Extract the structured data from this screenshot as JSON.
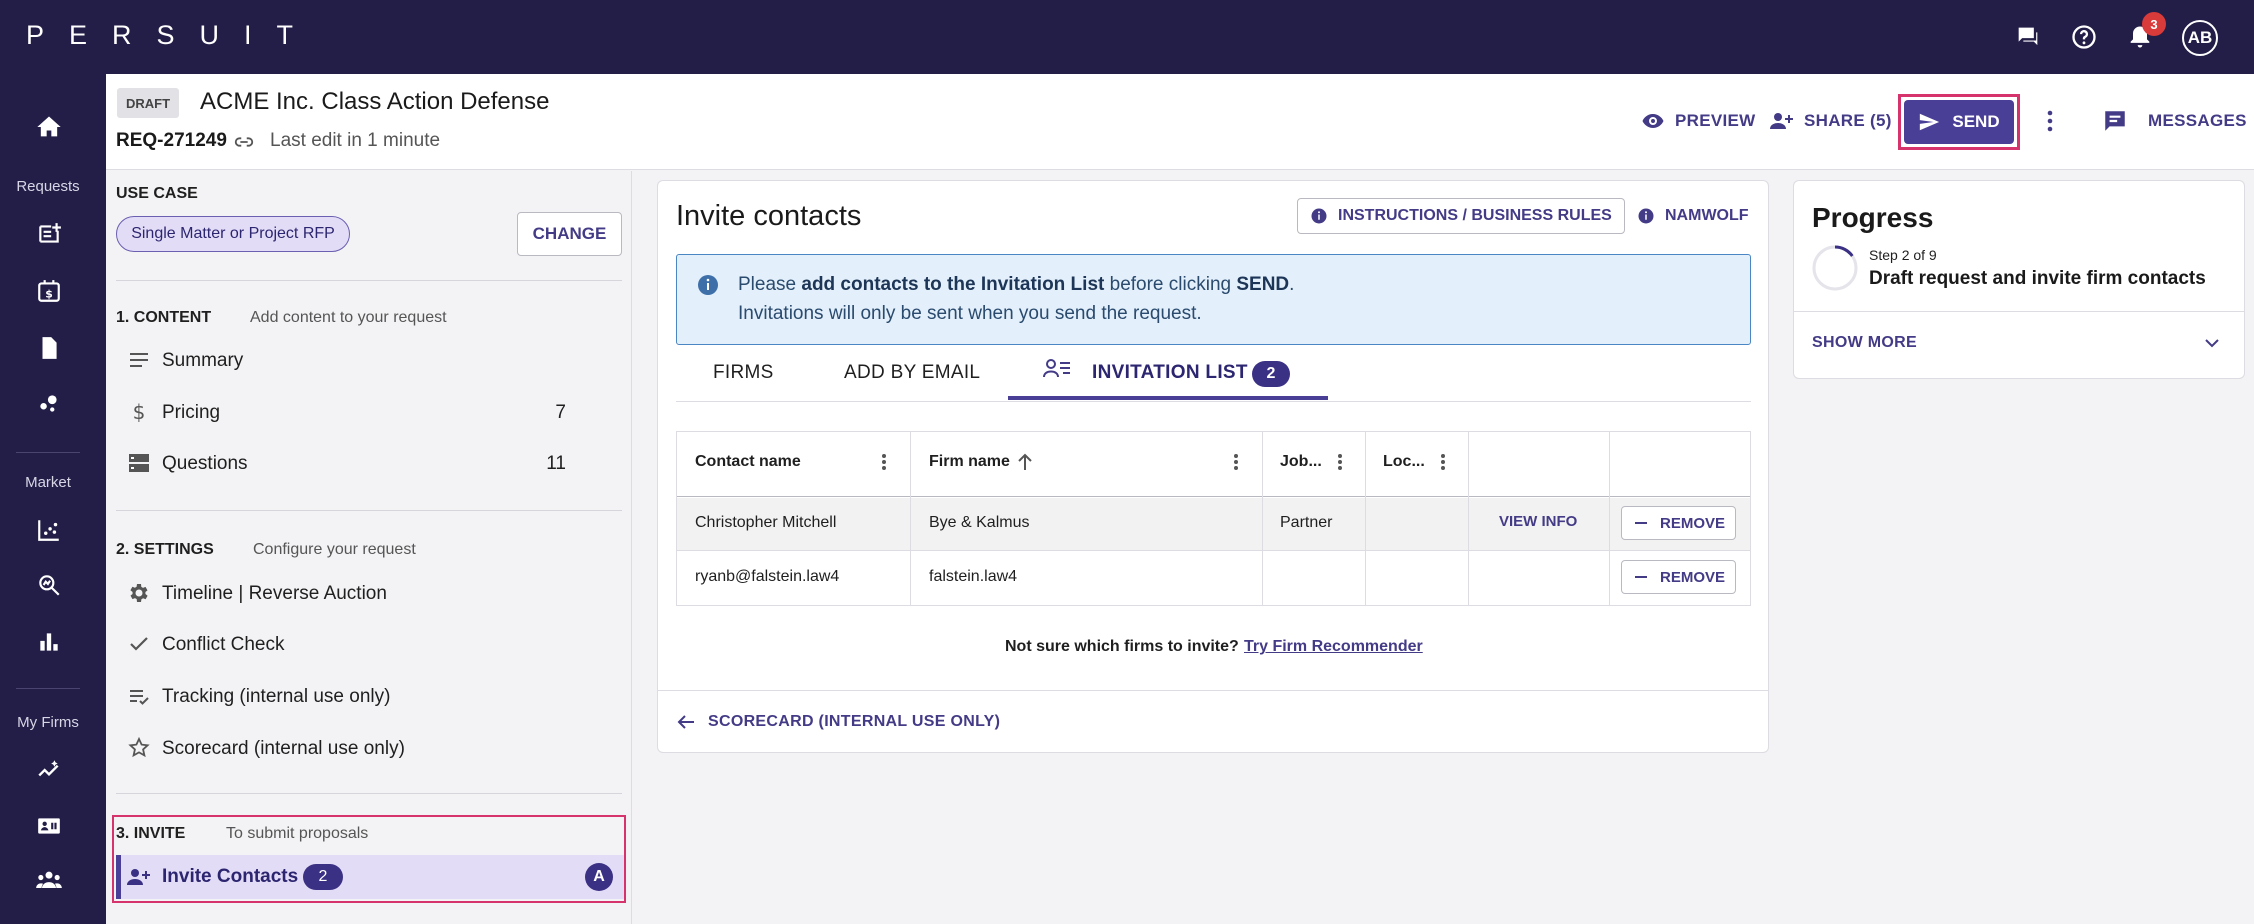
{
  "app": {
    "logo": "PERSUIT"
  },
  "topbar": {
    "notification_count": "3",
    "avatar_initials": "AB"
  },
  "leftnav": {
    "section_requests": "Requests",
    "section_market": "Market",
    "section_my_firms": "My Firms"
  },
  "header": {
    "status_badge": "DRAFT",
    "title": "ACME Inc. Class Action Defense",
    "request_id": "REQ-271249",
    "last_edit": "Last edit in 1 minute",
    "preview_label": "PREVIEW",
    "share_label": "SHARE (5)",
    "send_label": "SEND",
    "messages_label": "MESSAGES"
  },
  "sidebar": {
    "use_case_label": "USE CASE",
    "use_case_value": "Single Matter or Project RFP",
    "change_label": "CHANGE",
    "sections": [
      {
        "title": "1. CONTENT",
        "subtitle": "Add content to your request",
        "items": [
          {
            "label": "Summary",
            "count": ""
          },
          {
            "label": "Pricing",
            "count": "7"
          },
          {
            "label": "Questions",
            "count": "11"
          }
        ]
      },
      {
        "title": "2. SETTINGS",
        "subtitle": "Configure your request",
        "items": [
          {
            "label": "Timeline | Reverse Auction"
          },
          {
            "label": "Conflict Check"
          },
          {
            "label": "Tracking (internal use only)"
          },
          {
            "label": "Scorecard (internal use only)"
          }
        ]
      },
      {
        "title": "3. INVITE",
        "subtitle": "To submit proposals",
        "items": [
          {
            "label": "Invite Contacts",
            "count": "2",
            "status": "A"
          }
        ]
      }
    ]
  },
  "main": {
    "title": "Invite contacts",
    "instructions_label": "INSTRUCTIONS / BUSINESS RULES",
    "namwolf_label": "NAMWOLF",
    "banner": {
      "pre": "Please ",
      "bold1": "add contacts to the Invitation List",
      "mid": " before clicking ",
      "bold2": "SEND",
      "end": ".",
      "line2": "Invitations will only be sent when you send the request."
    },
    "tabs": [
      {
        "label": "FIRMS"
      },
      {
        "label": "ADD BY EMAIL"
      },
      {
        "label": "INVITATION LIST",
        "count": "2",
        "active": true
      }
    ],
    "table": {
      "columns": [
        "Contact name",
        "Firm name",
        "Job...",
        "Loc..."
      ],
      "rows": [
        {
          "contact": "Christopher Mitchell",
          "firm": "Bye & Kalmus",
          "job": "Partner",
          "location": "",
          "view_info": "VIEW INFO",
          "remove": "REMOVE"
        },
        {
          "contact": "ryanb@falstein.law4",
          "firm": "falstein.law4",
          "job": "",
          "location": "",
          "view_info": "",
          "remove": "REMOVE"
        }
      ]
    },
    "recommender_prompt": "Not sure which firms to invite?",
    "recommender_link": "Try Firm Recommender",
    "back_link": "SCORECARD (INTERNAL USE ONLY)"
  },
  "progress": {
    "title": "Progress",
    "step_of": "Step 2 of 9",
    "step_name": "Draft request and invite firm contacts",
    "show_more": "SHOW MORE"
  },
  "colors": {
    "nav_bg": "#231e47",
    "accent": "#4a3f96",
    "highlight": "#d6336c",
    "banner_bg": "#e3f0fb"
  }
}
